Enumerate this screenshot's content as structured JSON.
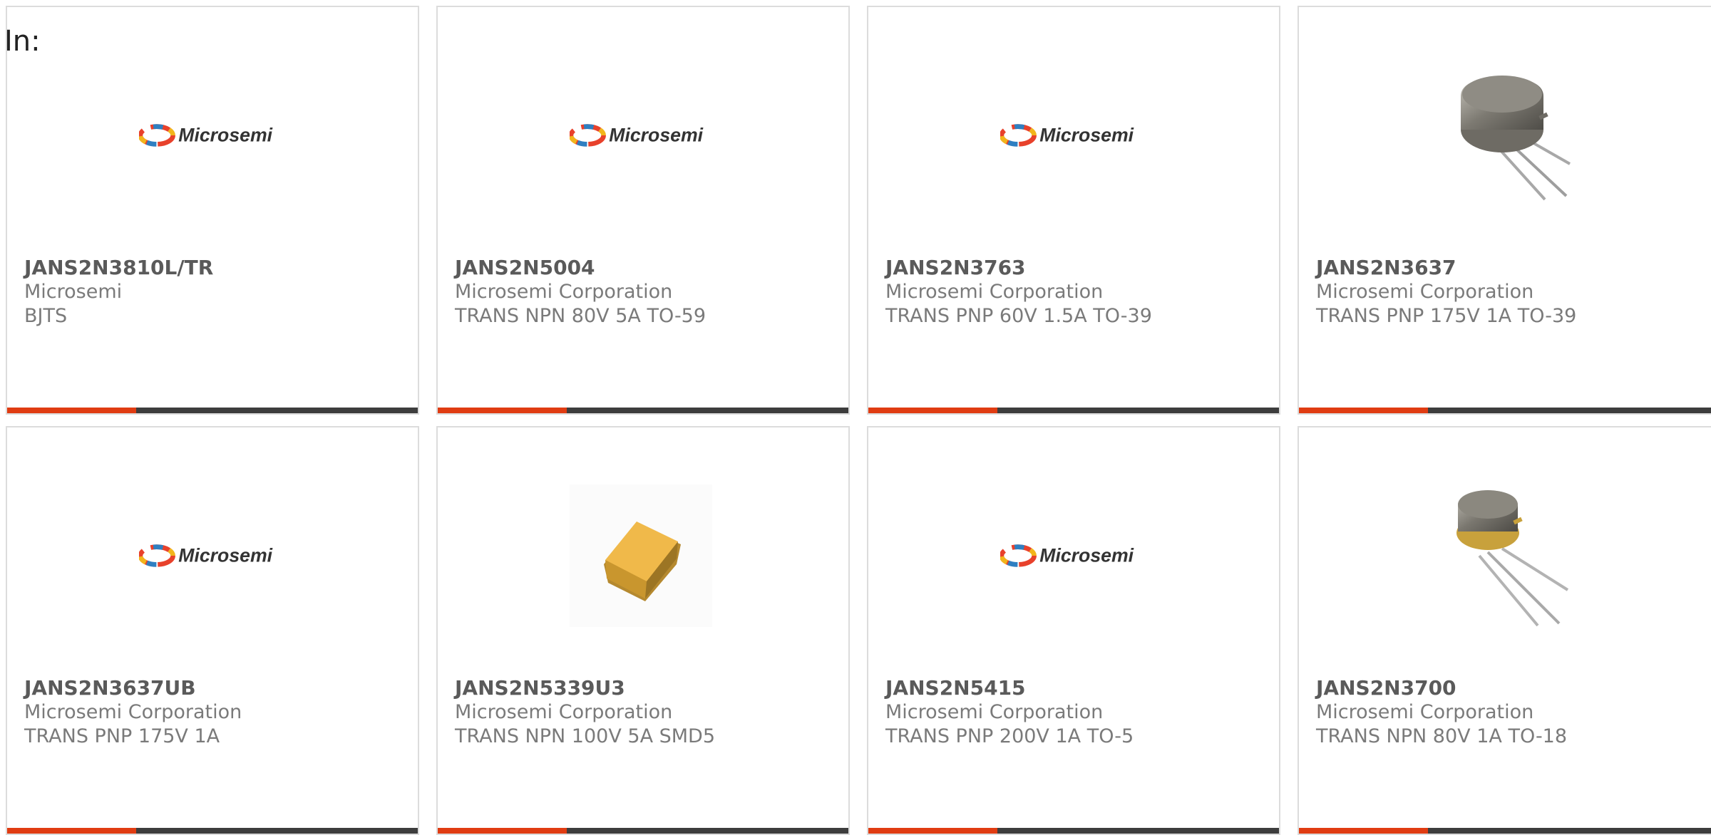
{
  "page": {
    "in_label": "In:"
  },
  "colors": {
    "accent": "#e03c12",
    "bar": "#3d3d3d",
    "border": "#dcdcdc"
  },
  "products": [
    {
      "part": "JANS2N3810L/TR",
      "manufacturer": "Microsemi",
      "description": "BJTS",
      "image": "microsemi-logo"
    },
    {
      "part": "JANS2N5004",
      "manufacturer": "Microsemi Corporation",
      "description": "TRANS NPN 80V 5A TO-59",
      "image": "microsemi-logo"
    },
    {
      "part": "JANS2N3763",
      "manufacturer": "Microsemi Corporation",
      "description": "TRANS PNP 60V 1.5A TO-39",
      "image": "microsemi-logo"
    },
    {
      "part": "JANS2N3637",
      "manufacturer": "Microsemi Corporation",
      "description": "TRANS PNP 175V 1A TO-39",
      "image": "to39-transistor"
    },
    {
      "part": "JANS2N3637UB",
      "manufacturer": "Microsemi Corporation",
      "description": "TRANS PNP 175V 1A",
      "image": "microsemi-logo"
    },
    {
      "part": "JANS2N5339U3",
      "manufacturer": "Microsemi Corporation",
      "description": "TRANS NPN 100V 5A SMD5",
      "image": "smd5-package"
    },
    {
      "part": "JANS2N5415",
      "manufacturer": "Microsemi Corporation",
      "description": "TRANS PNP 200V 1A TO-5",
      "image": "microsemi-logo"
    },
    {
      "part": "JANS2N3700",
      "manufacturer": "Microsemi Corporation",
      "description": "TRANS NPN 80V 1A TO-18",
      "image": "to18-transistor"
    }
  ],
  "logo_text": "Microsemi"
}
